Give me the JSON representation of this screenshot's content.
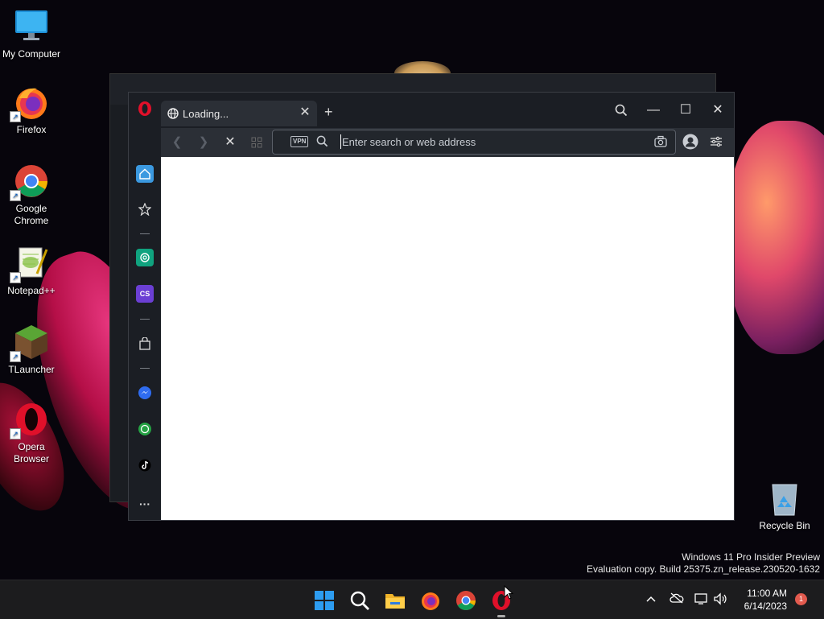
{
  "desktop": {
    "icons": [
      {
        "label": "My Computer"
      },
      {
        "label": "Firefox"
      },
      {
        "label": "Google Chrome"
      },
      {
        "label": "Notepad++"
      },
      {
        "label": "TLauncher"
      },
      {
        "label": "Opera Browser"
      },
      {
        "label": "Recycle Bin"
      }
    ],
    "watermark": {
      "line1": "Windows 11 Pro Insider Preview",
      "line2": "Evaluation copy. Build 25375.zn_release.230520-1632"
    }
  },
  "browser": {
    "tab": {
      "title": "Loading...",
      "close": "✕"
    },
    "new_tab": "+",
    "vpn_badge": "VPN",
    "address_placeholder": "Enter search or web address",
    "address_value": "",
    "window_controls": {
      "search": "search-icon",
      "minimize": "—",
      "maximize": "☐",
      "close": "✕"
    },
    "sidebar_items": [
      "home",
      "bookmarks",
      "chatgpt",
      "chatsonic",
      "shopping",
      "messenger",
      "whatsapp",
      "tiktok",
      "more"
    ],
    "chatsonic_label": "CS",
    "more_label": "···"
  },
  "taskbar": {
    "time": "11:00 AM",
    "date": "6/14/2023",
    "notifications": "1"
  },
  "colors": {
    "sidebar_active": "#3b99e0",
    "chatgpt": "#10a37f",
    "chatsonic": "#6b3fd4",
    "messenger": "#2f6cf0",
    "whatsapp": "#25a244"
  }
}
